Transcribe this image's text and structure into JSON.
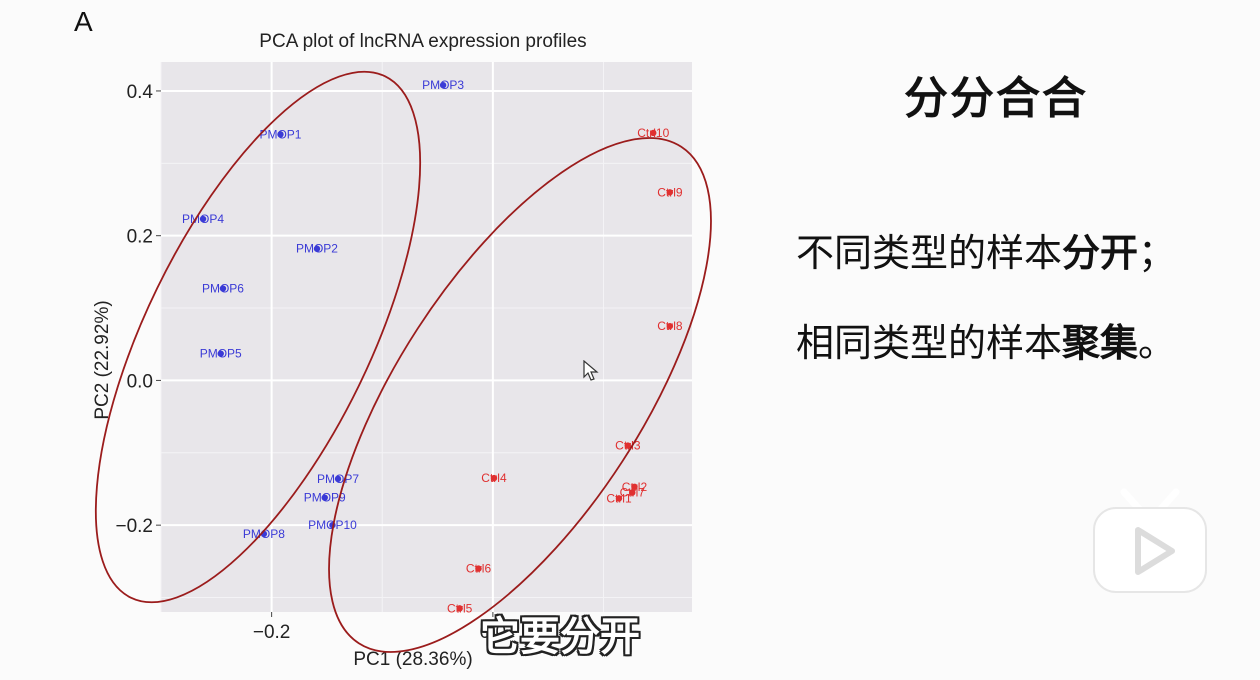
{
  "panel_letter": "A",
  "slide": {
    "title": "分分合合",
    "line1_plain": "不同类型的样本",
    "line1_bold": "分开",
    "line1_end": "；",
    "line2_plain": "相同类型的样本",
    "line2_bold": "聚集",
    "line2_end": "。"
  },
  "subtitle": "它要分开",
  "colors": {
    "pm": "#3a3ad6",
    "ctrl": "#e03030",
    "ellipse": "#9b1c1c",
    "panel_bg": "#e8e6ea",
    "grid": "#ffffff"
  },
  "icons": {
    "logo": "bilibili-tv-icon",
    "cursor": "mouse-pointer-icon"
  },
  "chart_data": {
    "type": "scatter",
    "title": "PCA plot of lncRNA expression profiles",
    "xlabel": "PC1 (28.36%)",
    "ylabel": "PC2 (22.92%)",
    "xlim": [
      -0.3,
      0.18
    ],
    "ylim": [
      -0.32,
      0.44
    ],
    "x_ticks": [
      -0.2,
      0.0
    ],
    "x_tick_labels": [
      "−0.2",
      "0.0"
    ],
    "y_ticks": [
      -0.2,
      0.0,
      0.2,
      0.4
    ],
    "y_tick_labels": [
      "−0.2",
      "0.0",
      "0.2",
      "0.4"
    ],
    "grid": true,
    "series": [
      {
        "group": "pm",
        "points": [
          {
            "label": "PMOP3",
            "x": -0.045,
            "y": 0.408
          },
          {
            "label": "PMOP1",
            "x": -0.192,
            "y": 0.34
          },
          {
            "label": "PMOP4",
            "x": -0.262,
            "y": 0.223
          },
          {
            "label": "PMOP2",
            "x": -0.159,
            "y": 0.182
          },
          {
            "label": "PMOP6",
            "x": -0.244,
            "y": 0.127
          },
          {
            "label": "PMOP5",
            "x": -0.246,
            "y": 0.037
          },
          {
            "label": "PMOP7",
            "x": -0.14,
            "y": -0.136
          },
          {
            "label": "PMOP9",
            "x": -0.152,
            "y": -0.162
          },
          {
            "label": "PMOP10",
            "x": -0.145,
            "y": -0.2
          },
          {
            "label": "PMOP8",
            "x": -0.207,
            "y": -0.212
          }
        ]
      },
      {
        "group": "ctrl",
        "points": [
          {
            "label": "Ctrl10",
            "x": 0.145,
            "y": 0.342
          },
          {
            "label": "Ctrl9",
            "x": 0.16,
            "y": 0.26
          },
          {
            "label": "Ctrl8",
            "x": 0.16,
            "y": 0.075
          },
          {
            "label": "Ctrl3",
            "x": 0.122,
            "y": -0.09
          },
          {
            "label": "Ctrl2",
            "x": 0.128,
            "y": -0.147
          },
          {
            "label": "Ctrl7",
            "x": 0.126,
            "y": -0.155
          },
          {
            "label": "Ctrl1",
            "x": 0.114,
            "y": -0.163
          },
          {
            "label": "Ctrl4",
            "x": 0.001,
            "y": -0.135
          },
          {
            "label": "Ctrl6",
            "x": -0.013,
            "y": -0.26
          },
          {
            "label": "Ctrl5",
            "x": -0.03,
            "y": -0.315
          }
        ]
      }
    ]
  }
}
